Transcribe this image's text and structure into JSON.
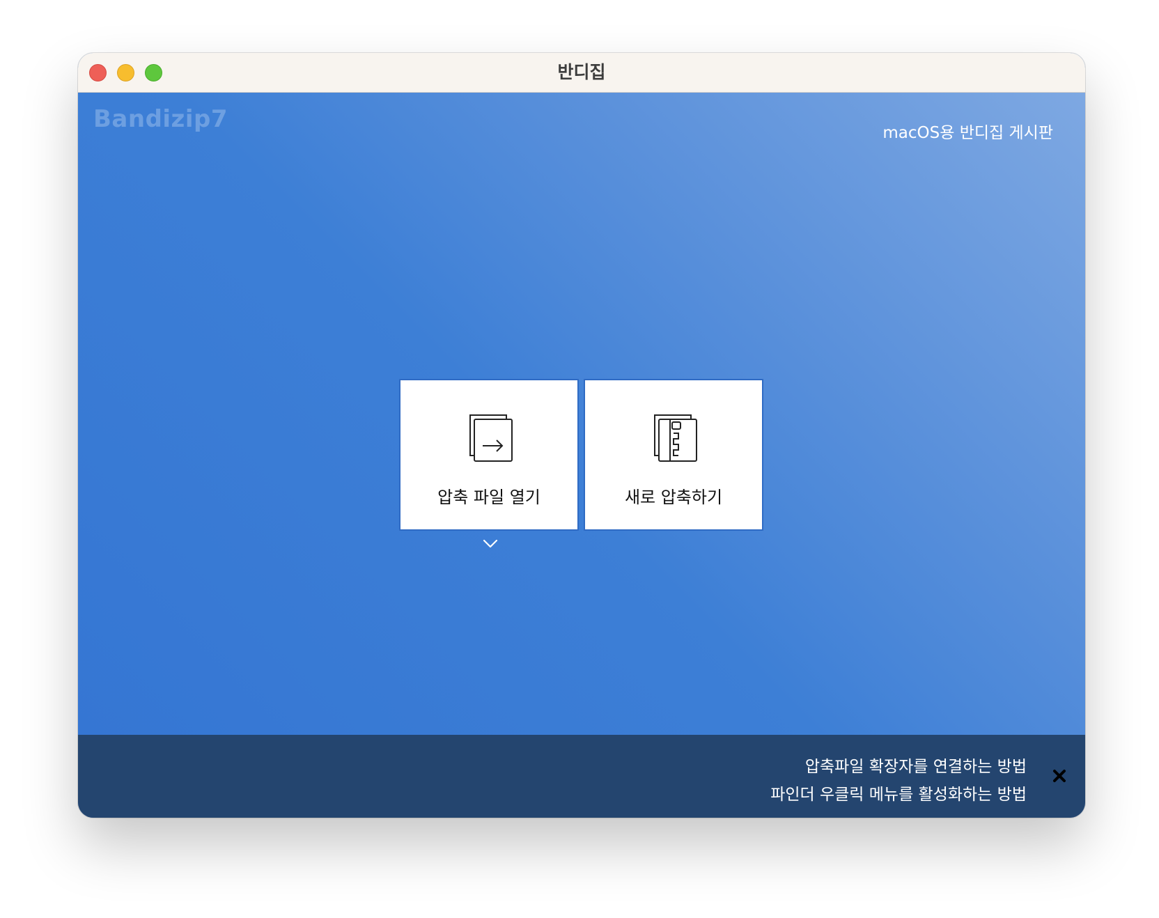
{
  "window": {
    "title": "반디집"
  },
  "main": {
    "brand_watermark": "Bandizip7",
    "board_link": "macOS용 반디집 게시판",
    "tiles": [
      {
        "label": "압축 파일 열기",
        "icon": "open-archive-icon"
      },
      {
        "label": "새로 압축하기",
        "icon": "new-archive-icon"
      }
    ],
    "dropdown_icon": "chevron-down-icon"
  },
  "footer": {
    "links": [
      "압축파일 확장자를 연결하는 방법",
      "파인더 우클릭 메뉴를 활성화하는 방법"
    ],
    "close_icon": "close-icon"
  },
  "colors": {
    "titlebar": "#f8f4ef",
    "content_gradient_start": "#7ea8e2",
    "content_gradient_end": "#3576d3",
    "footer": "#24456f",
    "tile": "#ffffff"
  }
}
